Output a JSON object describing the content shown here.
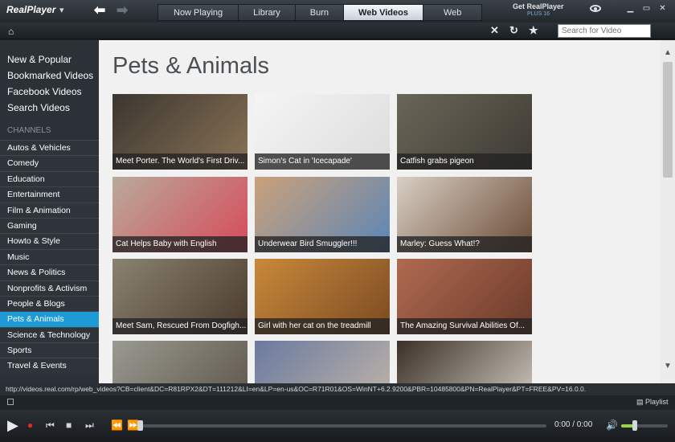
{
  "app": {
    "logo_text": "RealPlayer",
    "get_real_line1": "Get RealPlayer",
    "get_real_line2": "PLUS 16"
  },
  "tabs": [
    {
      "label": "Now Playing"
    },
    {
      "label": "Library"
    },
    {
      "label": "Burn"
    },
    {
      "label": "Web Videos",
      "active": true
    },
    {
      "label": "Web"
    }
  ],
  "toolbar": {
    "search_placeholder": "Search for Video"
  },
  "sidebar": {
    "top_links": [
      "New & Popular",
      "Bookmarked Videos",
      "Facebook Videos",
      "Search Videos"
    ],
    "channels_label": "CHANNELS",
    "categories": [
      "Autos & Vehicles",
      "Comedy",
      "Education",
      "Entertainment",
      "Film & Animation",
      "Gaming",
      "Howto & Style",
      "Music",
      "News & Politics",
      "Nonprofits & Activism",
      "People & Blogs",
      "Pets & Animals",
      "Science & Technology",
      "Sports",
      "Travel & Events"
    ],
    "active_category": "Pets & Animals"
  },
  "main": {
    "title": "Pets & Animals",
    "videos": [
      {
        "caption": "Meet Porter. The World's First Driv...",
        "colors": [
          "#3b3630",
          "#8a7355"
        ]
      },
      {
        "caption": "Simon's Cat in 'Icecapade'",
        "colors": [
          "#f5f5f5",
          "#dcdcdc"
        ]
      },
      {
        "caption": "Catfish grabs pigeon",
        "colors": [
          "#6a6658",
          "#3d3a33"
        ]
      },
      {
        "caption": "Cat Helps Baby with English",
        "colors": [
          "#b9aa9a",
          "#d74a5a"
        ]
      },
      {
        "caption": "Underwear Bird Smuggler!!!",
        "colors": [
          "#cba17a",
          "#5a86b8"
        ]
      },
      {
        "caption": "Marley: Guess What!?",
        "colors": [
          "#d8d0c4",
          "#6a4a35"
        ]
      },
      {
        "caption": "Meet Sam, Rescued From Dogfigh...",
        "colors": [
          "#8a8270",
          "#4a3a2c"
        ]
      },
      {
        "caption": "Girl with her cat on the treadmill",
        "colors": [
          "#c9893a",
          "#7a4a22"
        ]
      },
      {
        "caption": "The Amazing Survival Abilities Of...",
        "colors": [
          "#b06a50",
          "#6a3a2a"
        ]
      },
      {
        "caption": "",
        "colors": [
          "#9a9a90",
          "#5a5248"
        ]
      },
      {
        "caption": "",
        "colors": [
          "#6a7aa0",
          "#c4b8a8"
        ]
      },
      {
        "caption": "",
        "colors": [
          "#3a3028",
          "#d8d0c8"
        ]
      }
    ]
  },
  "status_url": "http://videos.real.com/rp/web_videos?CB=client&DC=R81RPX2&DT=111212&LI=en&LP=en-us&OC=R71R01&OS=WinNT+6.2.9200&PBR=10485800&PN=RealPlayer&PT=FREE&PV=16.0.0.",
  "playlist_label": "Playlist",
  "player": {
    "time": "0:00 / 0:00",
    "progress": 0,
    "volume": 0.3
  }
}
